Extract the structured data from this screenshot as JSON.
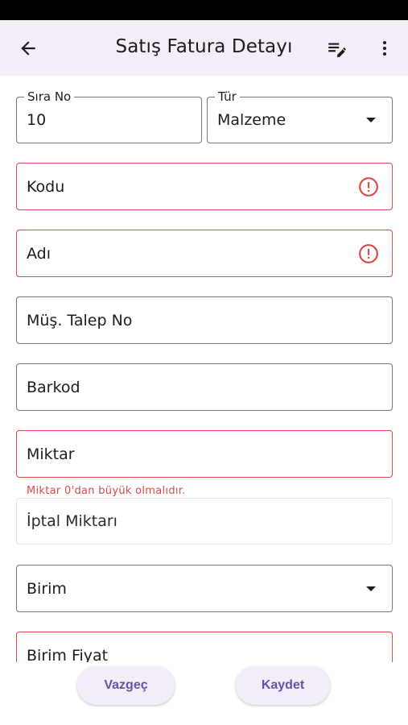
{
  "app_bar": {
    "title": "Satış Fatura Detayı",
    "back_icon": "arrow-left-icon",
    "edit_icon": "edit-note-icon",
    "more_icon": "more-vert-icon"
  },
  "form": {
    "sira_no": {
      "label": "Sıra No",
      "value": "10"
    },
    "tur": {
      "label": "Tür",
      "value": "Malzeme"
    },
    "kodu": {
      "placeholder": "Kodu"
    },
    "adi": {
      "placeholder": "Adı"
    },
    "mus_talep_no": {
      "placeholder": "Müş. Talep No"
    },
    "barkod": {
      "placeholder": "Barkod"
    },
    "miktar": {
      "placeholder": "Miktar",
      "error": "Miktar 0'dan büyük olmalıdır."
    },
    "iptal_miktari": {
      "placeholder": "İptal  Miktarı"
    },
    "birim": {
      "placeholder": "Birim"
    },
    "birim_fiyat": {
      "placeholder": "Birim Fiyat"
    }
  },
  "actions": {
    "cancel": "Vazgeç",
    "save": "Kaydet"
  },
  "colors": {
    "app_bar_bg": "#f3edf7",
    "error": "#d84a4a",
    "outline": "#79747e",
    "button_text": "#6750a4"
  }
}
